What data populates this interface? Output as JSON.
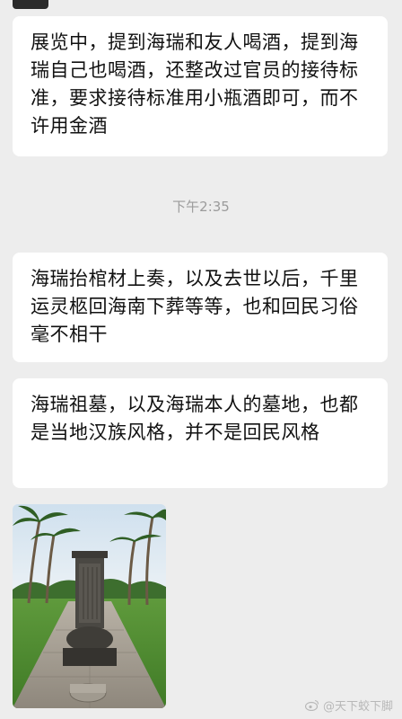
{
  "messages": [
    {
      "text": "展览中，提到海瑞和友人喝酒，提到海瑞自己也喝酒，还整改过官员的接待标准，要求接待标准用小瓶酒即可，而不许用金酒"
    },
    {
      "text": "海瑞抬棺材上奏，以及去世以后，千里运灵柩回海南下葬等等，也和回民习俗毫不相干"
    },
    {
      "text": "海瑞祖墓，以及海瑞本人的墓地，也都是当地汉族风格，并不是回民风格"
    }
  ],
  "timestamp": "下午2:35",
  "image": {
    "subject": "stone-tomb-stele-with-palm-trees"
  },
  "watermark": {
    "text": "@天下蛟下脚",
    "icon": "weibo-icon"
  },
  "colors": {
    "background": "#ededed",
    "bubble": "#ffffff",
    "timestamp": "#9b9b9b"
  }
}
